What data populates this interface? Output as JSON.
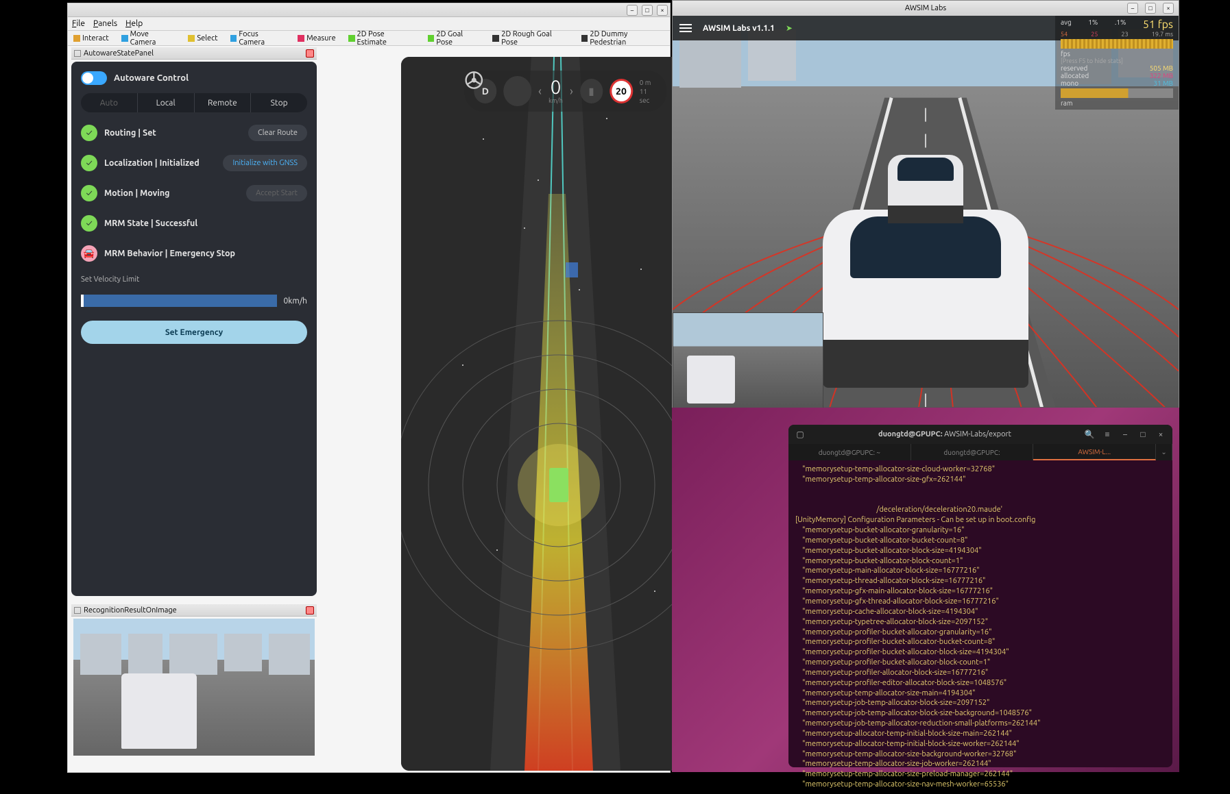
{
  "rviz": {
    "menus": {
      "file": "File",
      "panels": "Panels",
      "help": "Help"
    },
    "toolbar": {
      "interact": "Interact",
      "move_camera": "Move Camera",
      "select": "Select",
      "focus_camera": "Focus Camera",
      "measure": "Measure",
      "pose_estimate": "2D Pose Estimate",
      "goal_pose": "2D Goal Pose",
      "rough_goal_pose": "2D Rough Goal Pose",
      "dummy_pedestrian": "2D Dummy Pedestrian"
    },
    "state_panel_title": "AutowareStatePanel",
    "recog_panel_title": "RecognitionResultOnImage"
  },
  "state": {
    "control_label": "Autoware Control",
    "modes": {
      "auto": "Auto",
      "local": "Local",
      "remote": "Remote",
      "stop": "Stop"
    },
    "routing": "Routing | Set",
    "clear_route": "Clear Route",
    "localization": "Localization | Initialized",
    "init_gnss": "Initialize with GNSS",
    "motion": "Motion | Moving",
    "accept_start": "Accept Start",
    "mrm_state": "MRM State | Successful",
    "mrm_behavior": "MRM Behavior | Emergency Stop",
    "vel_limit_label": "Set Velocity Limit",
    "vel_value": "0km/h",
    "set_emergency": "Set Emergency"
  },
  "hud": {
    "gear": "D",
    "speed": "0",
    "speed_unit": "km/h",
    "limit": "20",
    "dist": "0 m",
    "time": "11 sec"
  },
  "awsim": {
    "window_title": "AWSIM Labs",
    "version": "AWSIM Labs v1.1.1",
    "stats": {
      "avg": "avg",
      "avg_pct1": "1%",
      "avg_pct2": ".1%",
      "fps": "51 fps",
      "row2_a": "54",
      "row2_b": "25",
      "row2_c": "23",
      "row2_d": "19.7 ms",
      "fps_label": "fps",
      "hint": "[Press F5 to hide stats]",
      "reserved": "reserved",
      "reserved_v": "505 MB",
      "allocated": "allocated",
      "allocated_v": "322 MB",
      "mono": "mono",
      "mono_v": "31 MB",
      "ram": "ram"
    }
  },
  "terminal": {
    "user_host": "duongtd@GPUPC:",
    "path": "AWSIM-Labs/export",
    "tabs": {
      "t1": "duongtd@GPUPC: ~",
      "t2": "duongtd@GPUPC:",
      "t3": "AWSIM-L..."
    },
    "lines": [
      "    \"memorysetup-temp-allocator-size-cloud-worker=32768\"",
      "    \"memorysetup-temp-allocator-size-gfx=262144\"",
      "",
      "",
      "                                               /deceleration/deceleration20.maude'",
      "[UnityMemory] Configuration Parameters - Can be set up in boot.config",
      "    \"memorysetup-bucket-allocator-granularity=16\"",
      "    \"memorysetup-bucket-allocator-bucket-count=8\"",
      "    \"memorysetup-bucket-allocator-block-size=4194304\"",
      "    \"memorysetup-bucket-allocator-block-count=1\"",
      "    \"memorysetup-main-allocator-block-size=16777216\"",
      "    \"memorysetup-thread-allocator-block-size=16777216\"",
      "    \"memorysetup-gfx-main-allocator-block-size=16777216\"",
      "    \"memorysetup-gfx-thread-allocator-block-size=16777216\"",
      "    \"memorysetup-cache-allocator-block-size=4194304\"",
      "    \"memorysetup-typetree-allocator-block-size=2097152\"",
      "    \"memorysetup-profiler-bucket-allocator-granularity=16\"",
      "    \"memorysetup-profiler-bucket-allocator-bucket-count=8\"",
      "    \"memorysetup-profiler-bucket-allocator-block-size=4194304\"",
      "    \"memorysetup-profiler-bucket-allocator-block-count=1\"",
      "    \"memorysetup-profiler-allocator-block-size=16777216\"",
      "    \"memorysetup-profiler-editor-allocator-block-size=1048576\"",
      "    \"memorysetup-temp-allocator-size-main=4194304\"",
      "    \"memorysetup-job-temp-allocator-block-size=2097152\"",
      "    \"memorysetup-job-temp-allocator-block-size-background=1048576\"",
      "    \"memorysetup-job-temp-allocator-reduction-small-platforms=262144\"",
      "    \"memorysetup-allocator-temp-initial-block-size-main=262144\"",
      "    \"memorysetup-allocator-temp-initial-block-size-worker=262144\"",
      "    \"memorysetup-temp-allocator-size-background-worker=32768\"",
      "    \"memorysetup-temp-allocator-size-job-worker=262144\"",
      "    \"memorysetup-temp-allocator-size-preload-manager=262144\"",
      "    \"memorysetup-temp-allocator-size-nav-mesh-worker=65536\""
    ]
  }
}
